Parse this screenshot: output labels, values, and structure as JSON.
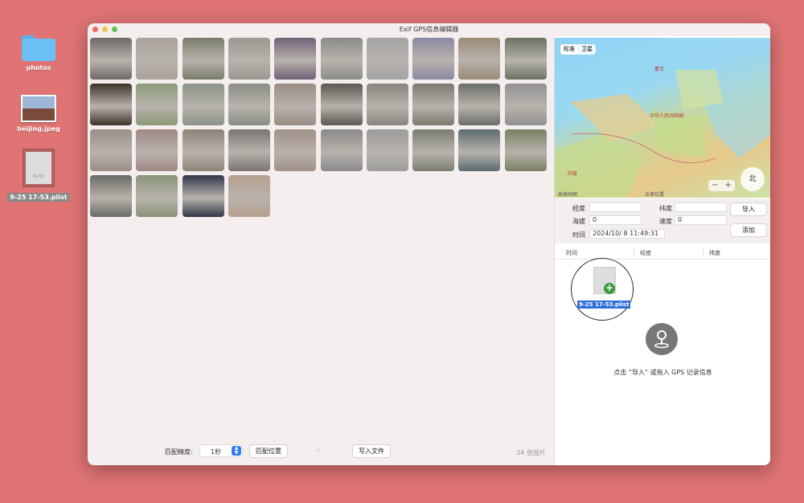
{
  "desktop": {
    "items": [
      {
        "label": "photos"
      },
      {
        "label": "beijing.jpeg"
      },
      {
        "label": "9-25 17-53.plist",
        "badge": "PLIST"
      }
    ]
  },
  "window": {
    "title": "Exif GPS信息编辑器"
  },
  "photos": {
    "colors": [
      "#6e6a66",
      "#a9a29c",
      "#7a7c6a",
      "#9a9891",
      "#6e6278",
      "#8a8c88",
      "#a2a4a6",
      "#8a8aa0",
      "#9a8a78",
      "#6a7262",
      "#3a3428",
      "#8c9a78",
      "#8a9488",
      "#8a8e84",
      "#9a8c84",
      "#5a5650",
      "#8a8480",
      "#7a7a70",
      "#6a6e68",
      "#929292",
      "#9a8e88",
      "#a08884",
      "#8a8478",
      "#7a7474",
      "#a09088",
      "#8a8a8a",
      "#9c9c9c",
      "#7a7e70",
      "#5a6a70",
      "#7a8064",
      "#6a6a64",
      "#8a9478",
      "#303848",
      "#b8a08e"
    ],
    "count_label": "34 张图片"
  },
  "toolbar": {
    "precision_label": "匹配精度:",
    "precision_value": "1秒",
    "match_button": "匹配位置",
    "write_button": "写入文件"
  },
  "map": {
    "tabs": [
      {
        "label": "标准"
      },
      {
        "label": "卫星"
      }
    ],
    "labels": [
      {
        "text": "蒙古"
      },
      {
        "text": "中华人民共和国"
      },
      {
        "text": "印度"
      }
    ],
    "compass": "北",
    "footer_left": "高德地图",
    "footer_right": "法律位置"
  },
  "fields": {
    "longitude_label": "经度",
    "longitude_value": "",
    "latitude_label": "纬度",
    "latitude_value": "",
    "altitude_label": "海拔",
    "altitude_value": "0",
    "speed_label": "速度",
    "speed_value": "0",
    "time_label": "时间",
    "time_value": "2024/10/ 8 11:49:31",
    "import_button": "导入",
    "add_button": "添加"
  },
  "list": {
    "columns": [
      "时间",
      "经度",
      "纬度"
    ],
    "drag_label": "9-25 17-53.plist",
    "empty_hint": "点击 “导入” 或拖入 GPS 记录信息"
  }
}
